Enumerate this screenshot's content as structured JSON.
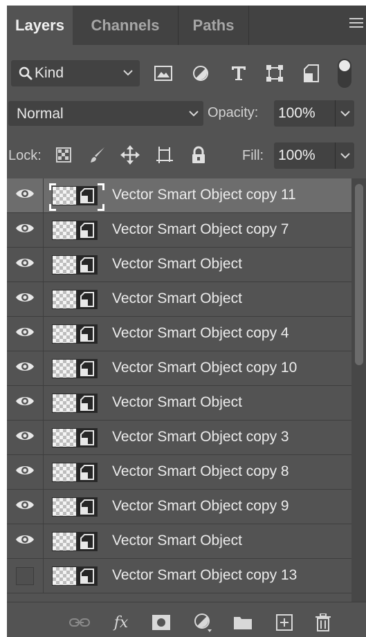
{
  "tabs": [
    {
      "label": "Layers",
      "active": true
    },
    {
      "label": "Channels",
      "active": false
    },
    {
      "label": "Paths",
      "active": false
    }
  ],
  "filter": {
    "kind_label": "Kind",
    "icons": [
      "image-filter-icon",
      "adjustment-filter-icon",
      "type-filter-icon",
      "shape-filter-icon",
      "smart-object-filter-icon",
      "filter-toggle-switch"
    ]
  },
  "blend": {
    "mode": "Normal",
    "opacity_label": "Opacity:",
    "opacity_value": "100%"
  },
  "lock": {
    "label": "Lock:",
    "icons": [
      "lock-transparent-pixels-icon",
      "lock-image-pixels-icon",
      "lock-position-icon",
      "lock-artboard-icon",
      "lock-all-icon"
    ],
    "fill_label": "Fill:",
    "fill_value": "100%"
  },
  "layers": [
    {
      "name": "Vector Smart Object copy 11",
      "visible": true,
      "selected": true
    },
    {
      "name": "Vector Smart Object copy 7",
      "visible": true,
      "selected": false
    },
    {
      "name": "Vector Smart Object",
      "visible": true,
      "selected": false
    },
    {
      "name": "Vector Smart Object",
      "visible": true,
      "selected": false
    },
    {
      "name": "Vector Smart Object copy 4",
      "visible": true,
      "selected": false
    },
    {
      "name": "Vector Smart Object copy 10",
      "visible": true,
      "selected": false
    },
    {
      "name": "Vector Smart Object",
      "visible": true,
      "selected": false
    },
    {
      "name": "Vector Smart Object copy 3",
      "visible": true,
      "selected": false
    },
    {
      "name": "Vector Smart Object copy 8",
      "visible": true,
      "selected": false
    },
    {
      "name": "Vector Smart Object copy 9",
      "visible": true,
      "selected": false
    },
    {
      "name": "Vector Smart Object",
      "visible": true,
      "selected": false
    },
    {
      "name": "Vector Smart Object copy 13",
      "visible": false,
      "selected": false
    }
  ],
  "bottom_bar": {
    "icons": [
      "link-layers-icon",
      "layer-style-fx-icon",
      "add-mask-icon",
      "new-adjustment-layer-icon",
      "new-group-folder-icon",
      "new-layer-icon",
      "delete-layer-trash-icon"
    ],
    "fx_label": "fx"
  },
  "colors": {
    "panel_bg": "#535353",
    "tab_bar_bg": "#424242",
    "selected_row": "#6d6d6d",
    "field_bg": "#424242"
  }
}
